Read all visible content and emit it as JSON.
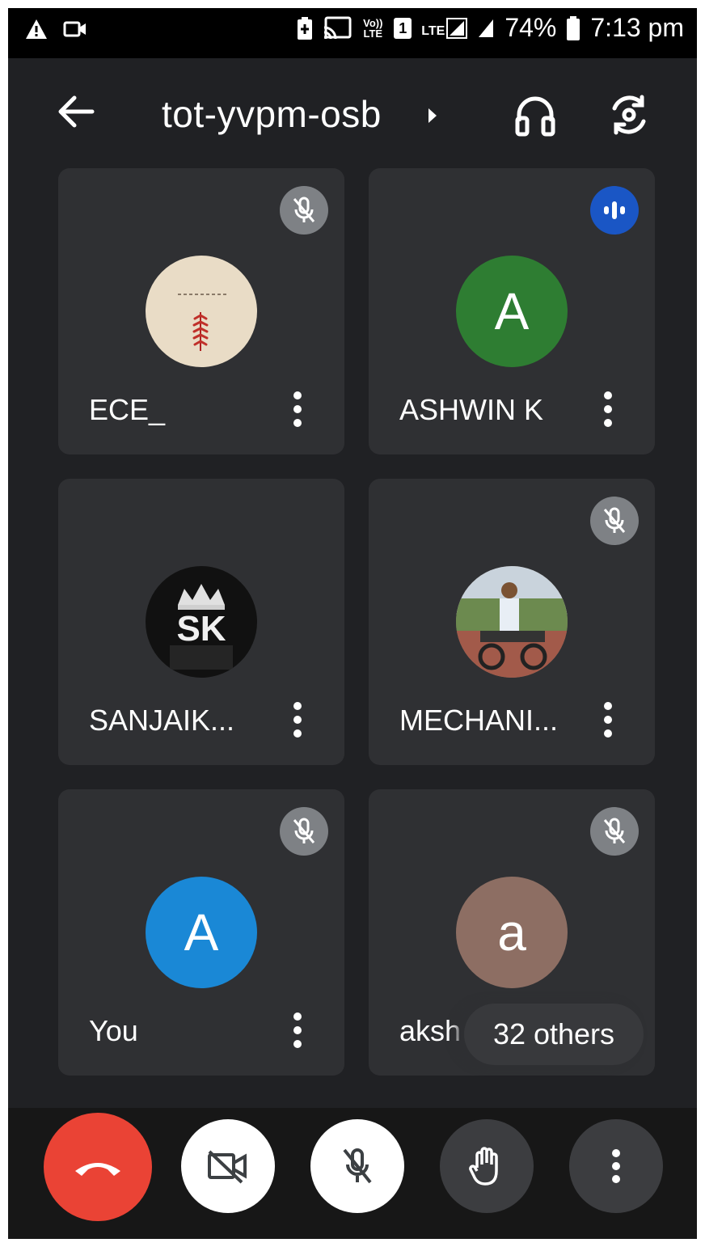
{
  "status_bar": {
    "battery_percent": "74%",
    "time": "7:13 pm",
    "volte": "Vo)) LTE",
    "sim_slot": "1",
    "network": "LTE",
    "icons": [
      "warning-icon",
      "video-camera-icon",
      "battery-saver-icon",
      "cast-icon",
      "volte-icon",
      "sim-icon",
      "lte-signal-icon",
      "signal-icon",
      "battery-icon"
    ]
  },
  "header": {
    "meeting_code": "tot-yvpm-osb",
    "icons": [
      "back-arrow-icon",
      "chevron-right-icon",
      "headphones-icon",
      "switch-camera-icon"
    ]
  },
  "participants": [
    {
      "name": "ECE_",
      "avatar_type": "image",
      "avatar_text": "",
      "status": "muted",
      "avatar_color": "#e9dcc6"
    },
    {
      "name": "ASHWIN K",
      "avatar_type": "letter",
      "avatar_text": "A",
      "status": "speaking",
      "avatar_color": "#2e7d32"
    },
    {
      "name": "SANJAIK...",
      "avatar_type": "image",
      "avatar_text": "SK",
      "status": "none",
      "avatar_color": "#111111"
    },
    {
      "name": "MECHANI...",
      "avatar_type": "image",
      "avatar_text": "",
      "status": "muted",
      "avatar_color": "#8a7a6a"
    },
    {
      "name": "You",
      "avatar_type": "letter",
      "avatar_text": "A",
      "status": "muted",
      "avatar_color": "#1a88d6"
    },
    {
      "name": "aksh",
      "avatar_type": "letter",
      "avatar_text": "a",
      "status": "muted",
      "avatar_color": "#8d6e63"
    }
  ],
  "others_chip": "32 others",
  "controls": {
    "icons": [
      "end-call-icon",
      "camera-off-icon",
      "mic-off-icon",
      "raise-hand-icon",
      "more-vert-icon"
    ]
  },
  "colors": {
    "background": "#202124",
    "tile": "#2f3033",
    "end_call": "#ea4335",
    "speaking": "#1a56c5"
  }
}
